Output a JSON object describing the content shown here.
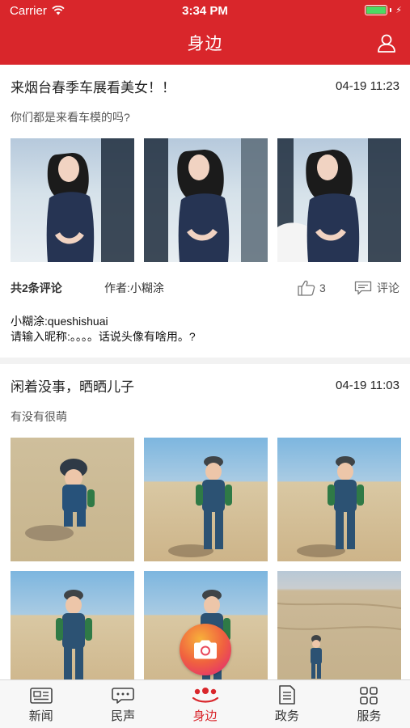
{
  "status_bar": {
    "carrier": "Carrier",
    "time": "3:34 PM",
    "battery_color": "#4cd964"
  },
  "header": {
    "title": "身边",
    "accent": "#d9262b"
  },
  "posts": [
    {
      "title": "来烟台春季车展看美女！！",
      "time": "04-19 11:23",
      "subtitle": "你们都是来看车模的吗?",
      "comment_count": "共2条评论",
      "author": "作者:小糊涂",
      "likes": "3",
      "comment_label": "评论",
      "comments": [
        "小糊涂:queshishuai",
        "请输入昵称:。。。。话说头像有啥用。?"
      ]
    },
    {
      "title": "闲着没事，晒晒儿子",
      "time": "04-19 11:03",
      "subtitle": "有没有很萌"
    }
  ],
  "tabs": [
    {
      "label": "新闻",
      "icon": "newspaper-icon"
    },
    {
      "label": "民声",
      "icon": "chat-bubble-icon"
    },
    {
      "label": "身边",
      "icon": "people-icon",
      "active": true
    },
    {
      "label": "政务",
      "icon": "document-icon"
    },
    {
      "label": "服务",
      "icon": "grid-icon"
    }
  ]
}
